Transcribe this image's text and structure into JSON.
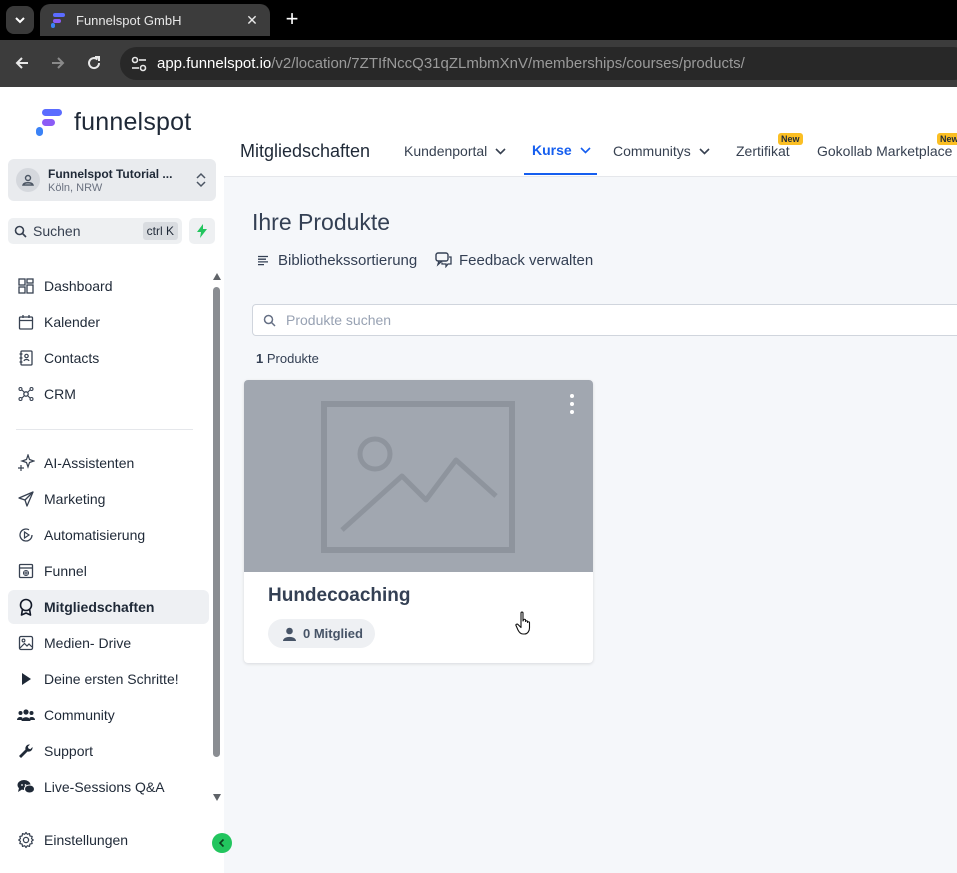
{
  "browser": {
    "tab_title": "Funnelspot GmbH",
    "url_host": "app.funnelspot.io",
    "url_path": "/v2/location/7ZTIfNccQ31qZLmbmXnV/memberships/courses/products/"
  },
  "sidebar": {
    "logo_text": "funnelspot",
    "account": {
      "name": "Funnelspot Tutorial ...",
      "location": "Köln, NRW"
    },
    "search": {
      "label": "Suchen",
      "shortcut": "ctrl K"
    },
    "items": [
      {
        "label": "Dashboard",
        "icon": "dashboard-icon"
      },
      {
        "label": "Kalender",
        "icon": "calendar-icon"
      },
      {
        "label": "Contacts",
        "icon": "contacts-icon"
      },
      {
        "label": "CRM",
        "icon": "crm-icon"
      },
      {
        "label": "AI-Assistenten",
        "icon": "sparkle-icon"
      },
      {
        "label": "Marketing",
        "icon": "send-icon"
      },
      {
        "label": "Automatisierung",
        "icon": "automation-icon"
      },
      {
        "label": "Funnel",
        "icon": "funnel-icon"
      },
      {
        "label": "Mitgliedschaften",
        "icon": "award-icon"
      },
      {
        "label": "Medien- Drive",
        "icon": "image-icon"
      },
      {
        "label": "Deine ersten Schritte!",
        "icon": "play-icon"
      },
      {
        "label": "Community",
        "icon": "people-icon"
      },
      {
        "label": "Support",
        "icon": "wrench-icon"
      },
      {
        "label": "Live-Sessions Q&A",
        "icon": "chat-icon"
      }
    ],
    "settings_label": "Einstellungen"
  },
  "header": {
    "section_title": "Mitgliedschaften",
    "tabs": [
      {
        "label": "Kundenportal"
      },
      {
        "label": "Kurse"
      },
      {
        "label": "Communitys"
      },
      {
        "label": "Zertifikat",
        "badge": "New"
      },
      {
        "label": "Gokollab Marketplace",
        "badge": "New"
      }
    ]
  },
  "main": {
    "title": "Ihre Produkte",
    "actions": {
      "sort": "Bibliothekssortierung",
      "feedback": "Feedback verwalten"
    },
    "search_placeholder": "Produkte suchen",
    "count_number": "1",
    "count_label": "Produkte",
    "products": [
      {
        "title": "Hundecoaching",
        "members": "0 Mitglied"
      }
    ]
  },
  "colors": {
    "accent": "#155eef",
    "active_bg": "#eef0f3",
    "thumb_bg": "#a1a7b0",
    "badge_new": "#fbbf24",
    "collapse_green": "#22c55e"
  }
}
